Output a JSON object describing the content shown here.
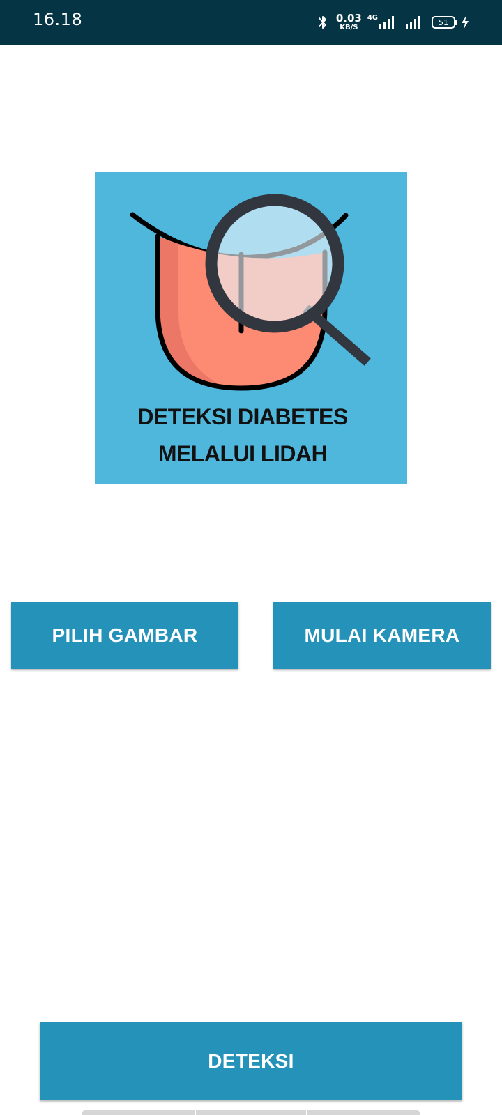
{
  "status_bar": {
    "time": "16.18",
    "net_speed_value": "0.03",
    "net_speed_unit": "KB/S",
    "network_type": "4G",
    "battery_level": "51",
    "icons": [
      "bluetooth-icon",
      "network-speed",
      "mobile-signal-icon",
      "signal-icon",
      "battery-icon",
      "charging-icon"
    ]
  },
  "logo": {
    "line1": "DETEKSI DIABETES",
    "line2": "MELALUI LIDAH",
    "icons": [
      "tongue-icon",
      "magnifier-icon"
    ]
  },
  "buttons": {
    "pick_image": "PILIH GAMBAR",
    "start_camera": "MULAI KAMERA",
    "detect": "DETEKSI"
  },
  "colors": {
    "status_bar_bg": "#053445",
    "logo_bg": "#4fb6dc",
    "button_bg": "#2592ba",
    "button_text": "#ffffff",
    "tongue": "#fd8a72",
    "tongue_shadow": "#ec7766",
    "magnifier_frame": "#32363e",
    "lens_tint": "#cce8f4"
  }
}
